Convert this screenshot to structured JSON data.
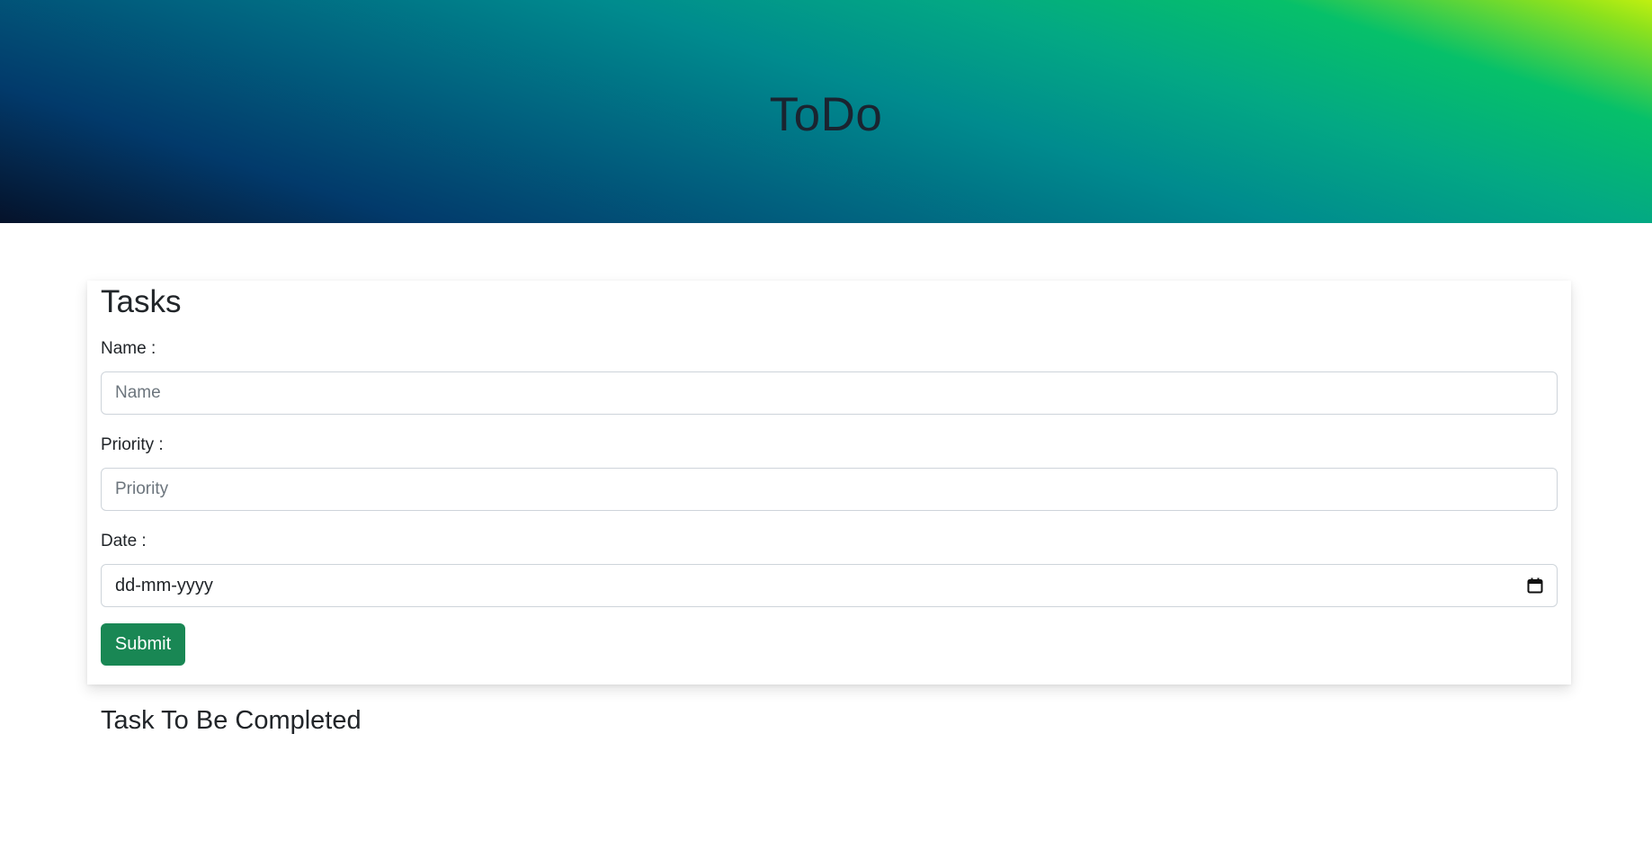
{
  "header": {
    "title": "ToDo"
  },
  "form": {
    "title": "Tasks",
    "name_label": "Name :",
    "name_placeholder": "Name",
    "priority_label": "Priority :",
    "priority_placeholder": "Priority",
    "date_label": "Date :",
    "date_placeholder": "dd-mm-yyyy",
    "date_icon": "calendar-icon",
    "submit_label": "Submit"
  },
  "tasks_section": {
    "heading": "Task To Be Completed"
  },
  "colors": {
    "submit_button": "#198754",
    "hero_gradient": [
      "#05122a",
      "#023a6b",
      "#008b8e",
      "#06c06a",
      "#c0f010"
    ]
  }
}
